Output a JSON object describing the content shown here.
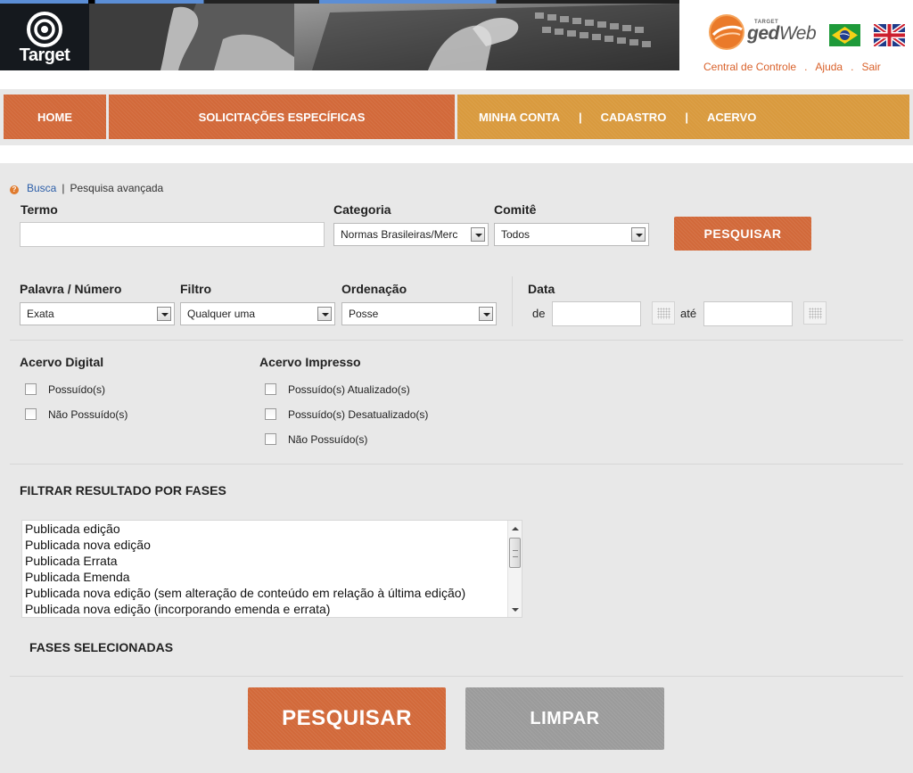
{
  "header": {
    "logo_text": "Target",
    "gedweb_small": "TARGET",
    "gedweb_word_bold": "ged",
    "gedweb_word_italic": "Web",
    "links": [
      "Central de Controle",
      "Ajuda",
      "Sair"
    ],
    "link_separator": "."
  },
  "nav": {
    "home": "HOME",
    "solicitacoes": "SOLICITAÇÕES ESPECÍFICAS",
    "minha_conta": "MINHA CONTA",
    "cadastro": "CADASTRO",
    "acervo": "ACERVO",
    "separator": "|"
  },
  "breadcrumb": {
    "help_icon": "?",
    "busca": "Busca",
    "separator": "|",
    "current": "Pesquisa avançada"
  },
  "search": {
    "termo_label": "Termo",
    "termo_value": "",
    "categoria_label": "Categoria",
    "categoria_value": "Normas Brasileiras/Merc",
    "comite_label": "Comitê",
    "comite_value": "Todos",
    "pesquisar_small": "PESQUISAR"
  },
  "filters": {
    "palavra_label": "Palavra / Número",
    "palavra_value": "Exata",
    "filtro_label": "Filtro",
    "filtro_value": "Qualquer uma",
    "ordenacao_label": "Ordenação",
    "ordenacao_value": "Posse",
    "data_label": "Data",
    "de_label": "de",
    "ate_label": "até"
  },
  "acervo_digital": {
    "title": "Acervo Digital",
    "options": [
      "Possuído(s)",
      "Não Possuído(s)"
    ]
  },
  "acervo_impresso": {
    "title": "Acervo Impresso",
    "options": [
      "Possuído(s) Atualizado(s)",
      "Possuído(s) Desatualizado(s)",
      "Não Possuído(s)"
    ]
  },
  "phases": {
    "title": "FILTRAR RESULTADO POR FASES",
    "options": [
      "Publicada edição",
      "Publicada nova edição",
      "Publicada Errata",
      "Publicada Emenda",
      "Publicada nova edição (sem alteração de conteúdo em relação à última edição)",
      "Publicada nova edição (incorporando emenda e errata)"
    ],
    "selected_title": "FASES SELECIONADAS"
  },
  "actions": {
    "pesquisar": "PESQUISAR",
    "limpar": "LIMPAR"
  },
  "colors": {
    "orange": "#d2693a",
    "gold": "#d99a3e",
    "link_orange": "#d9612a",
    "link_blue": "#2c5ea8",
    "panel_gray": "#e8e8e8"
  }
}
